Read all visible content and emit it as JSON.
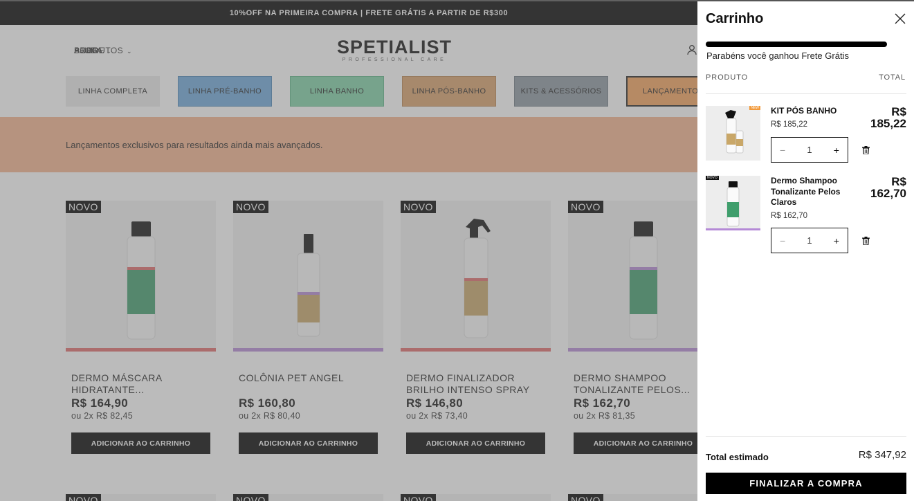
{
  "announcement": "10%OFF NA PRIMEIRA COMPRA | FRETE GRÁTIS A PARTIR DE R$300",
  "nav": [
    {
      "label": "PRODUTOS",
      "dropdown": true
    },
    {
      "label": "SOBRE",
      "dropdown": false
    },
    {
      "label": "AJUDA",
      "dropdown": true
    },
    {
      "label": "BLOG",
      "dropdown": false
    }
  ],
  "logo": {
    "main": "SPETIALIST",
    "sub": "PROFESSIONAL CARE"
  },
  "categories": [
    {
      "label": "LINHA COMPLETA"
    },
    {
      "label": "LINHA PRÉ-BANHO"
    },
    {
      "label": "LINHA BANHO"
    },
    {
      "label": "LINHA PÓS-BANHO"
    },
    {
      "label": "KITS & ACESSÓRIOS"
    },
    {
      "label": "LANÇAMENTOS"
    }
  ],
  "banner_text": "Lançamentos exclusivos para resultados ainda mais avançados.",
  "products": [
    {
      "badge": "NOVO",
      "name": "DERMO MÁSCARA HIDRATANTE...",
      "price": "R$ 164,90",
      "installments": "ou 2x R$ 82,45",
      "button": "ADICIONAR AO CARRINHO",
      "accent": "#e06a6a",
      "label_color": "#3f9e6c"
    },
    {
      "badge": "NOVO",
      "name": "COLÔNIA PET ANGEL",
      "price": "R$ 160,80",
      "installments": "ou 2x R$ 80,40",
      "button": "ADICIONAR AO CARRINHO",
      "accent": "#b58ad6",
      "label_color": "#c9a768"
    },
    {
      "badge": "NOVO",
      "name": "DERMO FINALIZADOR BRILHO INTENSO SPRAY",
      "price": "R$ 146,80",
      "installments": "ou 2x R$ 73,40",
      "button": "ADICIONAR AO CARRINHO",
      "accent": "#e06a6a",
      "label_color": "#c9a768"
    },
    {
      "badge": "NOVO",
      "name": "DERMO SHAMPOO TONALIZANTE PELOS...",
      "price": "R$ 162,70",
      "installments": "ou 2x R$ 81,35",
      "button": "ADICIONAR AO CARRINHO",
      "accent": "#b58ad6",
      "label_color": "#3f9e6c"
    }
  ],
  "products_row2_badges": [
    "NOVO",
    "NOVO",
    "NOVO",
    "NOVO"
  ],
  "cart": {
    "title": "Carrinho",
    "shipping_message": "Parabéns você ganhou Frete Grátis",
    "shipping_progress": 1.0,
    "col_product": "PRODUTO",
    "col_total": "TOTAL",
    "items": [
      {
        "name": "KIT PÓS BANHO",
        "unit_price": "R$ 185,22",
        "qty": "1",
        "total_currency": "R$",
        "total_value": "185,22",
        "thumb_tag": "NEW"
      },
      {
        "name": "Dermo Shampoo Tonalizante Pelos Claros",
        "unit_price": "R$ 162,70",
        "qty": "1",
        "total_currency": "R$",
        "total_value": "162,70",
        "thumb_tag": "NOVO"
      }
    ],
    "minus_symbol": "−",
    "plus_symbol": "+",
    "total_label": "Total estimado",
    "total_value": "R$ 347,92",
    "checkout_label": "FINALIZAR A COMPRA"
  },
  "colors": {
    "accent_black": "#000000",
    "banner": "#f6b48e",
    "overlay": "rgba(110,110,110,0.47)"
  }
}
